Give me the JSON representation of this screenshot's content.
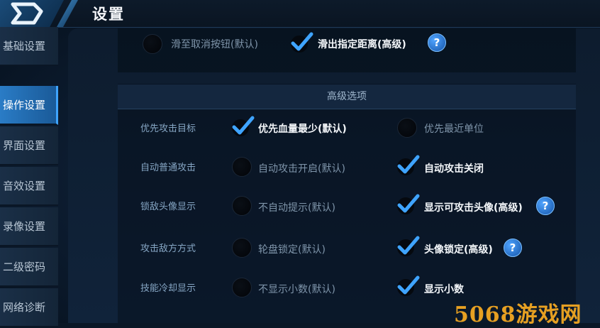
{
  "header": {
    "title": "设置"
  },
  "sidebar": {
    "items": [
      {
        "label": "基础设置",
        "active": false
      },
      {
        "label": "操作设置",
        "active": true
      },
      {
        "label": "界面设置",
        "active": false
      },
      {
        "label": "音效设置",
        "active": false
      },
      {
        "label": "录像设置",
        "active": false
      },
      {
        "label": "二级密码",
        "active": false
      },
      {
        "label": "网络诊断",
        "active": false
      }
    ]
  },
  "top_options": {
    "left": {
      "label": "滑至取消按钮(默认)",
      "checked": false
    },
    "right": {
      "label": "滑出指定距离(高级)",
      "checked": true
    }
  },
  "advanced": {
    "header": "高级选项",
    "rows": [
      {
        "label": "优先攻击目标",
        "opt1": "优先血量最少(默认)",
        "opt1_checked": true,
        "opt2": "优先最近单位",
        "opt2_checked": false
      },
      {
        "label": "自动普通攻击",
        "opt1": "自动攻击开启(默认)",
        "opt1_checked": false,
        "opt2": "自动攻击关闭",
        "opt2_checked": true
      },
      {
        "label": "锁敌头像显示",
        "opt1": "不自动提示(默认)",
        "opt1_checked": false,
        "opt2": "显示可攻击头像(高级)",
        "opt2_checked": true
      },
      {
        "label": "攻击敌方方式",
        "opt1": "轮盘锁定(默认)",
        "opt1_checked": false,
        "opt2": "头像锁定(高级)",
        "opt2_checked": true
      },
      {
        "label": "技能冷却显示",
        "opt1": "不显示小数(默认)",
        "opt1_checked": false,
        "opt2": "显示小数",
        "opt2_checked": true
      }
    ]
  },
  "help_label": "?",
  "watermark": {
    "digits": "5068",
    "text": "游戏网"
  },
  "colors": {
    "accent": "#2a7cc6",
    "check": "#3fa4ff",
    "watermark": "#e6a022"
  }
}
